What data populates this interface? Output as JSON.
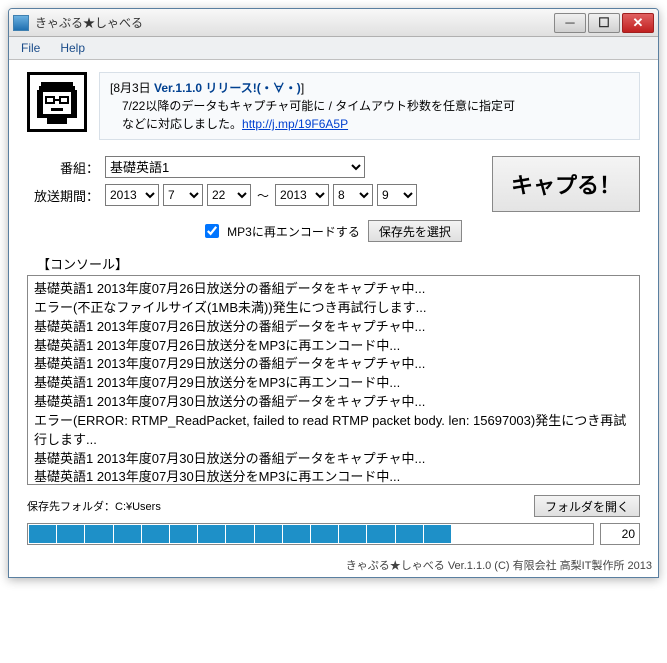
{
  "window": {
    "title": "きゃぷる★しゃべる"
  },
  "menu": {
    "file": "File",
    "help": "Help"
  },
  "news": {
    "title_prefix": "[8月3日 ",
    "title_version": "Ver.1.1.0 リリース!(・∀・)",
    "title_suffix": "]",
    "line2": "　7/22以降のデータもキャプチャ可能に / タイムアウト秒数を任意に指定可",
    "line3_prefix": "　などに対応しました。",
    "link_text": "http://j.mp/19F6A5P"
  },
  "controls": {
    "program_label": "番組：",
    "program_value": "基礎英語1",
    "period_label": "放送期間：",
    "from_year": "2013",
    "from_month": "7",
    "from_day": "22",
    "to_year": "2013",
    "to_month": "8",
    "to_day": "9",
    "tilde": "～",
    "capture_button": "キャプる！",
    "mp3_checkbox": "MP3に再エンコードする",
    "save_dest_button": "保存先を選択"
  },
  "console": {
    "label": "【コンソール】",
    "lines": [
      "基礎英語1 2013年度07月26日放送分の番組データをキャプチャ中...",
      "エラー(不正なファイルサイズ(1MB未満))発生につき再試行します...",
      "基礎英語1 2013年度07月26日放送分の番組データをキャプチャ中...",
      "基礎英語1 2013年度07月26日放送分をMP3に再エンコード中...",
      "基礎英語1 2013年度07月29日放送分の番組データをキャプチャ中...",
      "基礎英語1 2013年度07月29日放送分をMP3に再エンコード中...",
      "基礎英語1 2013年度07月30日放送分の番組データをキャプチャ中...",
      "エラー(ERROR: RTMP_ReadPacket, failed to read RTMP packet body. len: 15697003)発生につき再試行します...",
      "基礎英語1 2013年度07月30日放送分の番組データをキャプチャ中...",
      "基礎英語1 2013年度07月30日放送分をMP3に再エンコード中..."
    ]
  },
  "bottom": {
    "save_path_label": "保存先フォルダ：C:¥Users",
    "open_folder_button": "フォルダを開く"
  },
  "progress": {
    "filled": 15,
    "total": 20,
    "value": "20"
  },
  "footer": "きゃぷる★しゃべる Ver.1.1.0 (C) 有限会社 高梨IT製作所 2013"
}
